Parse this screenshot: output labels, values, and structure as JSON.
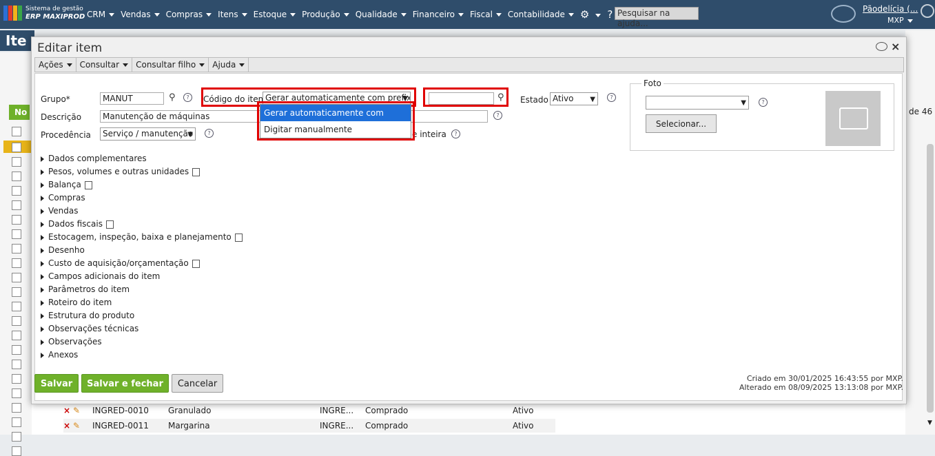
{
  "brand": {
    "line1": "Sistema de gestão",
    "line2": "ERP MAXIPROD"
  },
  "menu": [
    "CRM",
    "Vendas",
    "Compras",
    "Itens",
    "Estoque",
    "Produção",
    "Qualidade",
    "Financeiro",
    "Fiscal",
    "Contabilidade"
  ],
  "search": {
    "placeholder": "Pesquisar na ajuda..."
  },
  "user": {
    "name": "Pãodelícia (...",
    "code": "MXP"
  },
  "background": {
    "page_title": "Ite",
    "count": "de 46",
    "new_button": "No",
    "rows": [
      {
        "code": "INGRED-0010",
        "name": "Granulado",
        "group": "INGRE...",
        "origin": "Comprado",
        "status": "Ativo"
      },
      {
        "code": "INGRED-0011",
        "name": "Margarina",
        "group": "INGRE...",
        "origin": "Comprado",
        "status": "Ativo"
      }
    ]
  },
  "modal": {
    "title": "Editar item",
    "toolbar": [
      "Ações",
      "Consultar",
      "Consultar filho",
      "Ajuda"
    ],
    "fields": {
      "grupo_label": "Grupo*",
      "grupo_value": "MANUT",
      "codigo_label": "Código do item",
      "codigo_select": "Gerar automaticamente com prefixo",
      "codigo_value": "",
      "estado_label": "Estado",
      "estado_value": "Ativo",
      "descricao_label": "Descrição",
      "descricao_value": "Manutenção de máquinas",
      "procedencia_label": "Procedência",
      "procedencia_value": "Serviço / manutenção",
      "inteira_label": "e inteira"
    },
    "dropdown_options": [
      "Gerar automaticamente com prefixo",
      "Digitar manualmente"
    ],
    "sections": [
      {
        "label": "Dados complementares",
        "doc": false
      },
      {
        "label": "Pesos, volumes e outras unidades",
        "doc": true
      },
      {
        "label": "Balança",
        "doc": true
      },
      {
        "label": "Compras",
        "doc": false
      },
      {
        "label": "Vendas",
        "doc": false
      },
      {
        "label": "Dados fiscais",
        "doc": true
      },
      {
        "label": "Estocagem, inspeção, baixa e planejamento",
        "doc": true
      },
      {
        "label": "Desenho",
        "doc": false
      },
      {
        "label": "Custo de aquisição/orçamentação",
        "doc": true
      },
      {
        "label": "Campos adicionais do item",
        "doc": false
      },
      {
        "label": "Parâmetros do item",
        "doc": false
      },
      {
        "label": "Roteiro do item",
        "doc": false
      },
      {
        "label": "Estrutura do produto",
        "doc": false
      },
      {
        "label": "Observações técnicas",
        "doc": false
      },
      {
        "label": "Observações",
        "doc": false
      },
      {
        "label": "Anexos",
        "doc": false
      }
    ],
    "foto": {
      "legend": "Foto",
      "select_value": "",
      "select_button": "Selecionar..."
    },
    "buttons": {
      "save": "Salvar",
      "save_close": "Salvar e fechar",
      "cancel": "Cancelar"
    },
    "meta": {
      "created": "Criado em 30/01/2025 16:43:55 por MXP.",
      "updated": "Alterado em 08/09/2025 13:13:08 por MXP."
    }
  },
  "colors": {
    "topbar": "#2f4d6b",
    "green": "#6fb12a",
    "highlight": "#e00000",
    "selected_option": "#1e6fd9"
  }
}
